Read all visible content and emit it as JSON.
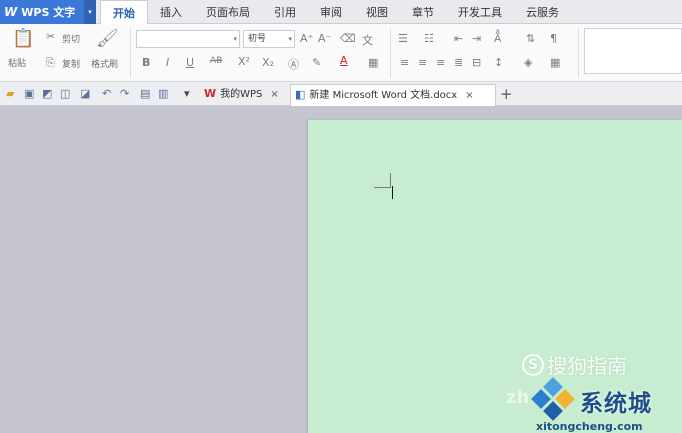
{
  "app": {
    "name": "WPS 文字",
    "logo_glyph": "W",
    "menu_caret": "▾",
    "accent": "#3b78d8"
  },
  "menu_tabs": [
    "开始",
    "插入",
    "页面布局",
    "引用",
    "审阅",
    "视图",
    "章节",
    "开发工具",
    "云服务"
  ],
  "active_tab": "开始",
  "ribbon": {
    "paste_label": "粘贴",
    "cut_label": "剪切",
    "copy_label": "复制",
    "format_painter_label": "格式刷",
    "font_name_value": "",
    "font_size_value": "初号",
    "bold": "B",
    "italic": "I",
    "underline": "U",
    "strikethrough": "AB",
    "superscript": "X²",
    "subscript": "X₂",
    "font_color": "A"
  },
  "document_tabs": [
    {
      "label": "我的WPS",
      "close": "×"
    },
    {
      "label": "新建 Microsoft Word 文档.docx",
      "close": "×"
    }
  ],
  "new_tab": "+",
  "page_background": "#c8ecd0",
  "watermarks": {
    "sogou": {
      "text": "搜狗指南",
      "glyph": "S"
    },
    "zh_faint": "zh",
    "site": {
      "name": "系统城",
      "url": "xitongcheng.com"
    }
  }
}
